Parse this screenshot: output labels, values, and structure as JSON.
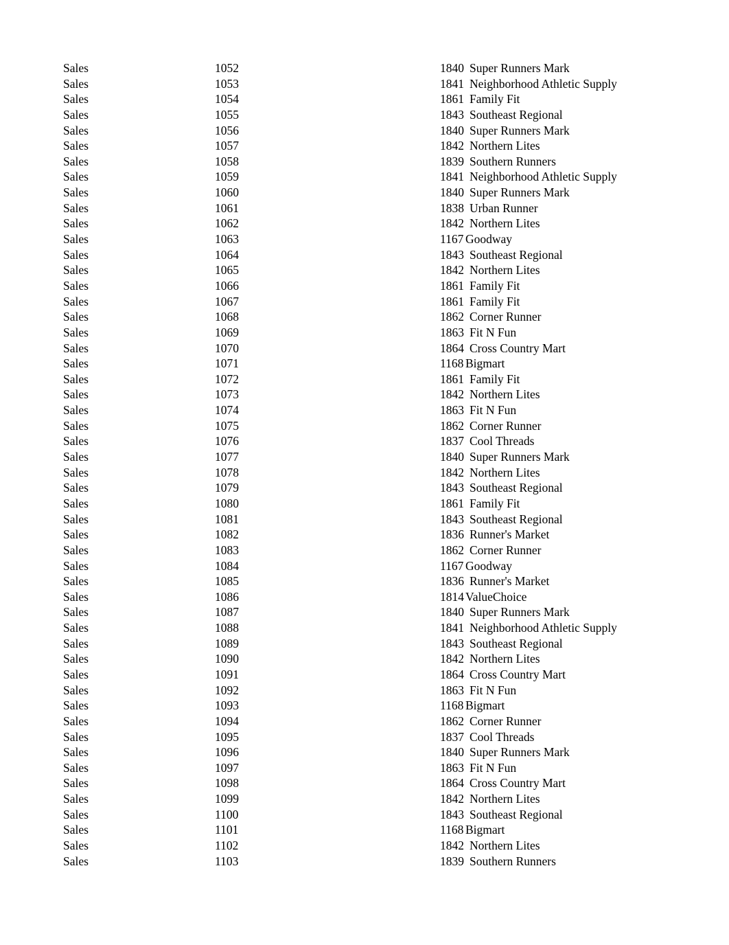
{
  "document": {
    "kind": "plain-text-report",
    "background_color": "#ffffff",
    "text_color": "#000000",
    "columns": [
      "department",
      "order_id",
      "customer_id",
      "customer_name"
    ]
  },
  "rows": [
    {
      "department": "Sales",
      "order_id": "1052",
      "customer_id": "1840",
      "customer_name": "Super Runners Mark",
      "tight": false
    },
    {
      "department": "Sales",
      "order_id": "1053",
      "customer_id": "1841",
      "customer_name": "Neighborhood Athletic Supply",
      "tight": false
    },
    {
      "department": "Sales",
      "order_id": "1054",
      "customer_id": "1861",
      "customer_name": "Family Fit",
      "tight": false
    },
    {
      "department": "Sales",
      "order_id": "1055",
      "customer_id": "1843",
      "customer_name": "Southeast Regional",
      "tight": false
    },
    {
      "department": "Sales",
      "order_id": "1056",
      "customer_id": "1840",
      "customer_name": "Super Runners Mark",
      "tight": false
    },
    {
      "department": "Sales",
      "order_id": "1057",
      "customer_id": "1842",
      "customer_name": "Northern Lites",
      "tight": false
    },
    {
      "department": "Sales",
      "order_id": "1058",
      "customer_id": "1839",
      "customer_name": "Southern Runners",
      "tight": false
    },
    {
      "department": "Sales",
      "order_id": "1059",
      "customer_id": "1841",
      "customer_name": "Neighborhood Athletic Supply",
      "tight": false
    },
    {
      "department": "Sales",
      "order_id": "1060",
      "customer_id": "1840",
      "customer_name": "Super Runners Mark",
      "tight": false
    },
    {
      "department": "Sales",
      "order_id": "1061",
      "customer_id": "1838",
      "customer_name": "Urban Runner",
      "tight": false
    },
    {
      "department": "Sales",
      "order_id": "1062",
      "customer_id": "1842",
      "customer_name": "Northern Lites",
      "tight": false
    },
    {
      "department": "Sales",
      "order_id": "1063",
      "customer_id": "1167",
      "customer_name": "Goodway",
      "tight": true
    },
    {
      "department": "Sales",
      "order_id": "1064",
      "customer_id": "1843",
      "customer_name": "Southeast Regional",
      "tight": false
    },
    {
      "department": "Sales",
      "order_id": "1065",
      "customer_id": "1842",
      "customer_name": "Northern Lites",
      "tight": false
    },
    {
      "department": "Sales",
      "order_id": "1066",
      "customer_id": "1861",
      "customer_name": "Family Fit",
      "tight": false
    },
    {
      "department": "Sales",
      "order_id": "1067",
      "customer_id": "1861",
      "customer_name": "Family Fit",
      "tight": false
    },
    {
      "department": "Sales",
      "order_id": "1068",
      "customer_id": "1862",
      "customer_name": "Corner Runner",
      "tight": false
    },
    {
      "department": "Sales",
      "order_id": "1069",
      "customer_id": "1863",
      "customer_name": "Fit N Fun",
      "tight": false
    },
    {
      "department": "Sales",
      "order_id": "1070",
      "customer_id": "1864",
      "customer_name": "Cross Country Mart",
      "tight": false
    },
    {
      "department": "Sales",
      "order_id": "1071",
      "customer_id": "1168",
      "customer_name": "Bigmart",
      "tight": true
    },
    {
      "department": "Sales",
      "order_id": "1072",
      "customer_id": "1861",
      "customer_name": "Family Fit",
      "tight": false
    },
    {
      "department": "Sales",
      "order_id": "1073",
      "customer_id": "1842",
      "customer_name": "Northern Lites",
      "tight": false
    },
    {
      "department": "Sales",
      "order_id": "1074",
      "customer_id": "1863",
      "customer_name": "Fit N Fun",
      "tight": false
    },
    {
      "department": "Sales",
      "order_id": "1075",
      "customer_id": "1862",
      "customer_name": "Corner Runner",
      "tight": false
    },
    {
      "department": "Sales",
      "order_id": "1076",
      "customer_id": "1837",
      "customer_name": "Cool Threads",
      "tight": false
    },
    {
      "department": "Sales",
      "order_id": "1077",
      "customer_id": "1840",
      "customer_name": "Super Runners Mark",
      "tight": false
    },
    {
      "department": "Sales",
      "order_id": "1078",
      "customer_id": "1842",
      "customer_name": "Northern Lites",
      "tight": false
    },
    {
      "department": "Sales",
      "order_id": "1079",
      "customer_id": "1843",
      "customer_name": "Southeast Regional",
      "tight": false
    },
    {
      "department": "Sales",
      "order_id": "1080",
      "customer_id": "1861",
      "customer_name": "Family Fit",
      "tight": false
    },
    {
      "department": "Sales",
      "order_id": "1081",
      "customer_id": "1843",
      "customer_name": "Southeast Regional",
      "tight": false
    },
    {
      "department": "Sales",
      "order_id": "1082",
      "customer_id": "1836",
      "customer_name": "Runner's Market",
      "tight": false
    },
    {
      "department": "Sales",
      "order_id": "1083",
      "customer_id": "1862",
      "customer_name": "Corner Runner",
      "tight": false
    },
    {
      "department": "Sales",
      "order_id": "1084",
      "customer_id": "1167",
      "customer_name": "Goodway",
      "tight": true
    },
    {
      "department": "Sales",
      "order_id": "1085",
      "customer_id": "1836",
      "customer_name": "Runner's Market",
      "tight": false
    },
    {
      "department": "Sales",
      "order_id": "1086",
      "customer_id": "1814",
      "customer_name": "ValueChoice",
      "tight": true
    },
    {
      "department": "Sales",
      "order_id": "1087",
      "customer_id": "1840",
      "customer_name": "Super Runners Mark",
      "tight": false
    },
    {
      "department": "Sales",
      "order_id": "1088",
      "customer_id": "1841",
      "customer_name": "Neighborhood Athletic Supply",
      "tight": false
    },
    {
      "department": "Sales",
      "order_id": "1089",
      "customer_id": "1843",
      "customer_name": "Southeast Regional",
      "tight": false
    },
    {
      "department": "Sales",
      "order_id": "1090",
      "customer_id": "1842",
      "customer_name": "Northern Lites",
      "tight": false
    },
    {
      "department": "Sales",
      "order_id": "1091",
      "customer_id": "1864",
      "customer_name": "Cross Country Mart",
      "tight": false
    },
    {
      "department": "Sales",
      "order_id": "1092",
      "customer_id": "1863",
      "customer_name": "Fit N Fun",
      "tight": false
    },
    {
      "department": "Sales",
      "order_id": "1093",
      "customer_id": "1168",
      "customer_name": "Bigmart",
      "tight": true
    },
    {
      "department": "Sales",
      "order_id": "1094",
      "customer_id": "1862",
      "customer_name": "Corner Runner",
      "tight": false
    },
    {
      "department": "Sales",
      "order_id": "1095",
      "customer_id": "1837",
      "customer_name": "Cool Threads",
      "tight": false
    },
    {
      "department": "Sales",
      "order_id": "1096",
      "customer_id": "1840",
      "customer_name": "Super Runners Mark",
      "tight": false
    },
    {
      "department": "Sales",
      "order_id": "1097",
      "customer_id": "1863",
      "customer_name": "Fit N Fun",
      "tight": false
    },
    {
      "department": "Sales",
      "order_id": "1098",
      "customer_id": "1864",
      "customer_name": "Cross Country Mart",
      "tight": false
    },
    {
      "department": "Sales",
      "order_id": "1099",
      "customer_id": "1842",
      "customer_name": "Northern Lites",
      "tight": false
    },
    {
      "department": "Sales",
      "order_id": "1100",
      "customer_id": "1843",
      "customer_name": "Southeast Regional",
      "tight": false
    },
    {
      "department": "Sales",
      "order_id": "1101",
      "customer_id": "1168",
      "customer_name": "Bigmart",
      "tight": true
    },
    {
      "department": "Sales",
      "order_id": "1102",
      "customer_id": "1842",
      "customer_name": "Northern Lites",
      "tight": false
    },
    {
      "department": "Sales",
      "order_id": "1103",
      "customer_id": "1839",
      "customer_name": "Southern Runners",
      "tight": false
    }
  ]
}
